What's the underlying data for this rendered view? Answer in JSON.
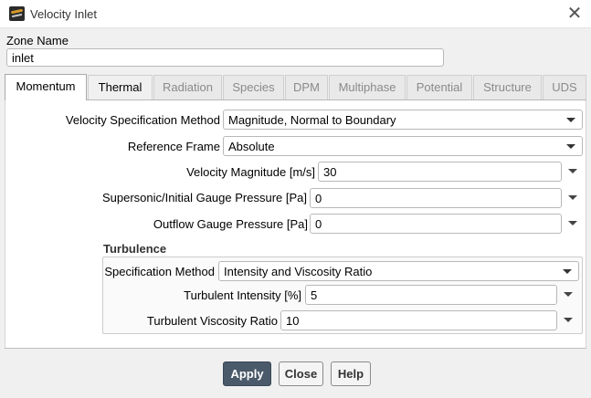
{
  "window": {
    "title": "Velocity Inlet",
    "close_icon": "close-icon"
  },
  "zone": {
    "label": "Zone Name",
    "value": "inlet"
  },
  "tabs": [
    {
      "label": "Momentum",
      "state": "active"
    },
    {
      "label": "Thermal",
      "state": "enabled"
    },
    {
      "label": "Radiation",
      "state": "disabled"
    },
    {
      "label": "Species",
      "state": "disabled"
    },
    {
      "label": "DPM",
      "state": "disabled"
    },
    {
      "label": "Multiphase",
      "state": "disabled"
    },
    {
      "label": "Potential",
      "state": "disabled"
    },
    {
      "label": "Structure",
      "state": "disabled"
    },
    {
      "label": "UDS",
      "state": "disabled"
    }
  ],
  "momentum": {
    "velocity_spec": {
      "label": "Velocity Specification Method",
      "value": "Magnitude, Normal to Boundary"
    },
    "reference_frame": {
      "label": "Reference Frame",
      "value": "Absolute"
    },
    "velocity_magnitude": {
      "label": "Velocity Magnitude [m/s]",
      "value": "30"
    },
    "supersonic_pressure": {
      "label": "Supersonic/Initial Gauge Pressure [Pa]",
      "value": "0"
    },
    "outflow_pressure": {
      "label": "Outflow Gauge Pressure [Pa]",
      "value": "0"
    }
  },
  "turbulence": {
    "title": "Turbulence",
    "spec_method": {
      "label": "Specification Method",
      "value": "Intensity and Viscosity Ratio"
    },
    "intensity": {
      "label": "Turbulent Intensity [%]",
      "value": "5"
    },
    "viscosity_ratio": {
      "label": "Turbulent Viscosity Ratio",
      "value": "10"
    }
  },
  "buttons": {
    "apply": "Apply",
    "close": "Close",
    "help": "Help"
  },
  "colors": {
    "primary_button": "#4a5a6a",
    "panel": "#ffffff",
    "background": "#f0f0f0"
  }
}
